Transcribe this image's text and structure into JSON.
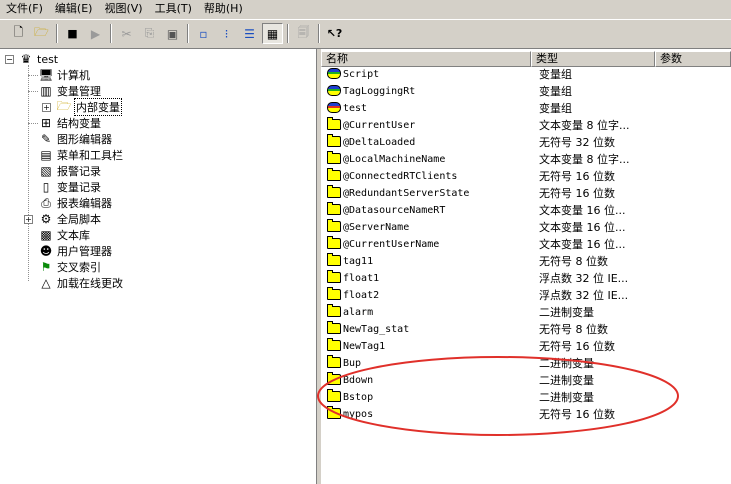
{
  "menu": [
    "文件(F)",
    "编辑(E)",
    "视图(V)",
    "工具(T)",
    "帮助(H)"
  ],
  "toolbar": {
    "buttons": [
      {
        "name": "new-icon",
        "glyph": "🗋"
      },
      {
        "name": "open-icon",
        "glyph": "📂"
      },
      {
        "name": "stop-icon",
        "glyph": "■"
      },
      {
        "name": "play-icon",
        "glyph": "▶"
      },
      {
        "name": "cut-icon",
        "glyph": "✂"
      },
      {
        "name": "copy-icon",
        "glyph": "⎘"
      },
      {
        "name": "paste-icon",
        "glyph": "📋"
      },
      {
        "name": "large-icons-icon",
        "glyph": "▫"
      },
      {
        "name": "small-icons-icon",
        "glyph": "⁝"
      },
      {
        "name": "list-icon",
        "glyph": "☰"
      },
      {
        "name": "details-icon",
        "glyph": "▦"
      },
      {
        "name": "properties-icon",
        "glyph": "🗐"
      },
      {
        "name": "help-pointer-icon",
        "glyph": "↖?"
      }
    ]
  },
  "tree": {
    "root": "test",
    "items": [
      {
        "label": "计算机",
        "icon": "computer-icon"
      },
      {
        "label": "变量管理",
        "icon": "tag-management-icon"
      },
      {
        "label": "内部变量",
        "icon": "internal-tags-icon"
      },
      {
        "label": "结构变量",
        "icon": "structure-tags-icon"
      },
      {
        "label": "图形编辑器",
        "icon": "graphics-designer-icon"
      },
      {
        "label": "菜单和工具栏",
        "icon": "menu-toolbar-icon"
      },
      {
        "label": "报警记录",
        "icon": "alarm-logging-icon"
      },
      {
        "label": "变量记录",
        "icon": "tag-logging-icon"
      },
      {
        "label": "报表编辑器",
        "icon": "report-designer-icon"
      },
      {
        "label": "全局脚本",
        "icon": "global-script-icon"
      },
      {
        "label": "文本库",
        "icon": "text-library-icon"
      },
      {
        "label": "用户管理器",
        "icon": "user-administrator-icon"
      },
      {
        "label": "交叉索引",
        "icon": "cross-reference-icon"
      },
      {
        "label": "加载在线更改",
        "icon": "load-online-changes-icon"
      }
    ]
  },
  "list": {
    "columns": [
      "名称",
      "类型",
      "参数"
    ],
    "rows": [
      {
        "name": "Script",
        "type": "变量组",
        "icon": "group"
      },
      {
        "name": "TagLoggingRt",
        "type": "变量组",
        "icon": "group"
      },
      {
        "name": "test",
        "type": "变量组",
        "icon": "group"
      },
      {
        "name": "@CurrentUser",
        "type": "文本变量 8 位字...",
        "icon": "tag"
      },
      {
        "name": "@DeltaLoaded",
        "type": "无符号 32 位数",
        "icon": "tag"
      },
      {
        "name": "@LocalMachineName",
        "type": "文本变量 8 位字...",
        "icon": "tag"
      },
      {
        "name": "@ConnectedRTClients",
        "type": "无符号 16 位数",
        "icon": "tag"
      },
      {
        "name": "@RedundantServerState",
        "type": "无符号 16 位数",
        "icon": "tag"
      },
      {
        "name": "@DatasourceNameRT",
        "type": "文本变量 16 位...",
        "icon": "tag"
      },
      {
        "name": "@ServerName",
        "type": "文本变量 16 位...",
        "icon": "tag"
      },
      {
        "name": "@CurrentUserName",
        "type": "文本变量 16 位...",
        "icon": "tag"
      },
      {
        "name": "tag11",
        "type": "无符号 8 位数",
        "icon": "tag"
      },
      {
        "name": "float1",
        "type": "浮点数 32 位 IE...",
        "icon": "tag"
      },
      {
        "name": "float2",
        "type": "浮点数 32 位 IE...",
        "icon": "tag"
      },
      {
        "name": "alarm",
        "type": "二进制变量",
        "icon": "tag"
      },
      {
        "name": "NewTag_stat",
        "type": "无符号 8 位数",
        "icon": "tag"
      },
      {
        "name": "NewTag1",
        "type": "无符号 16 位数",
        "icon": "tag"
      },
      {
        "name": "Bup",
        "type": "二进制变量",
        "icon": "tag"
      },
      {
        "name": "Bdown",
        "type": "二进制变量",
        "icon": "tag"
      },
      {
        "name": "Bstop",
        "type": "二进制变量",
        "icon": "tag"
      },
      {
        "name": "mypos",
        "type": "无符号 16 位数",
        "icon": "tag"
      }
    ]
  },
  "colors": {
    "annotation": "#e0302a",
    "window_bg": "#d4d0c8"
  }
}
